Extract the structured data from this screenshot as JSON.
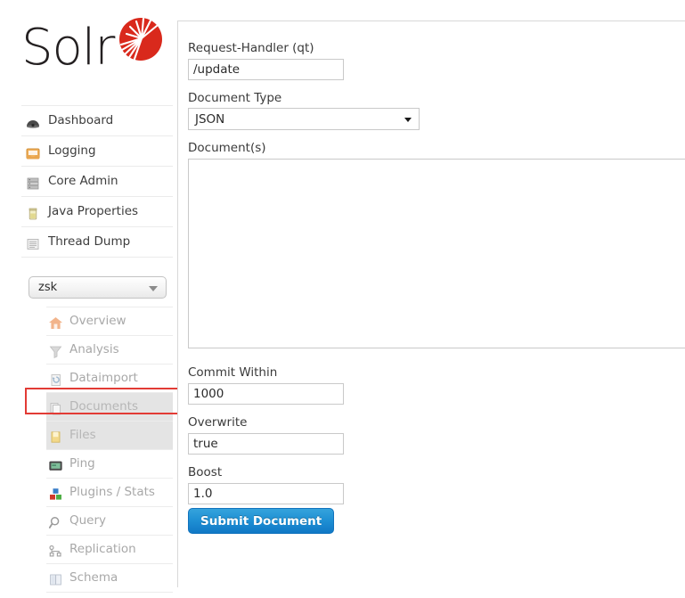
{
  "app": {
    "logo_text": "Solr",
    "logo_mark": "solr-sunburst-icon"
  },
  "sidebar": {
    "main_nav": [
      {
        "label": "Dashboard",
        "icon": "dashboard-icon"
      },
      {
        "label": "Logging",
        "icon": "logging-tray-icon"
      },
      {
        "label": "Core Admin",
        "icon": "server-stack-icon"
      },
      {
        "label": "Java Properties",
        "icon": "java-jar-icon"
      },
      {
        "label": "Thread Dump",
        "icon": "thread-dump-icon"
      }
    ],
    "core_selector": {
      "value": "zsk",
      "arrow_icon": "chevron-down-icon"
    },
    "core_nav": [
      {
        "label": "Overview",
        "icon": "home-icon",
        "state": "normal"
      },
      {
        "label": "Analysis",
        "icon": "funnel-icon",
        "state": "normal"
      },
      {
        "label": "Dataimport",
        "icon": "dataimport-icon",
        "state": "normal"
      },
      {
        "label": "Documents",
        "icon": "documents-icon",
        "state": "shaded"
      },
      {
        "label": "Files",
        "icon": "files-folder-icon",
        "state": "shaded"
      },
      {
        "label": "Ping",
        "icon": "ping-monitor-icon",
        "state": "normal"
      },
      {
        "label": "Plugins / Stats",
        "icon": "plugins-blocks-icon",
        "state": "normal"
      },
      {
        "label": "Query",
        "icon": "magnifier-icon",
        "state": "normal"
      },
      {
        "label": "Replication",
        "icon": "replication-nodes-icon",
        "state": "normal"
      },
      {
        "label": "Schema",
        "icon": "open-book-icon",
        "state": "normal"
      }
    ],
    "annotation": {
      "target": "Documents",
      "color": "#e23b35"
    }
  },
  "form": {
    "request_handler": {
      "label": "Request-Handler (qt)",
      "value": "/update"
    },
    "document_type": {
      "label": "Document Type",
      "value": "JSON",
      "arrow_icon": "caret-down-icon"
    },
    "documents": {
      "label": "Document(s)",
      "value": "",
      "placeholder": ""
    },
    "commit_within": {
      "label": "Commit Within",
      "value": "1000"
    },
    "overwrite": {
      "label": "Overwrite",
      "value": "true"
    },
    "boost": {
      "label": "Boost",
      "value": "1.0"
    },
    "submit": {
      "label": "Submit Document"
    }
  },
  "colors": {
    "brand_red": "#d9291c",
    "button_blue": "#1e8fd3",
    "annotation_red": "#e23b35",
    "shaded_row": "#e4e4e4"
  }
}
